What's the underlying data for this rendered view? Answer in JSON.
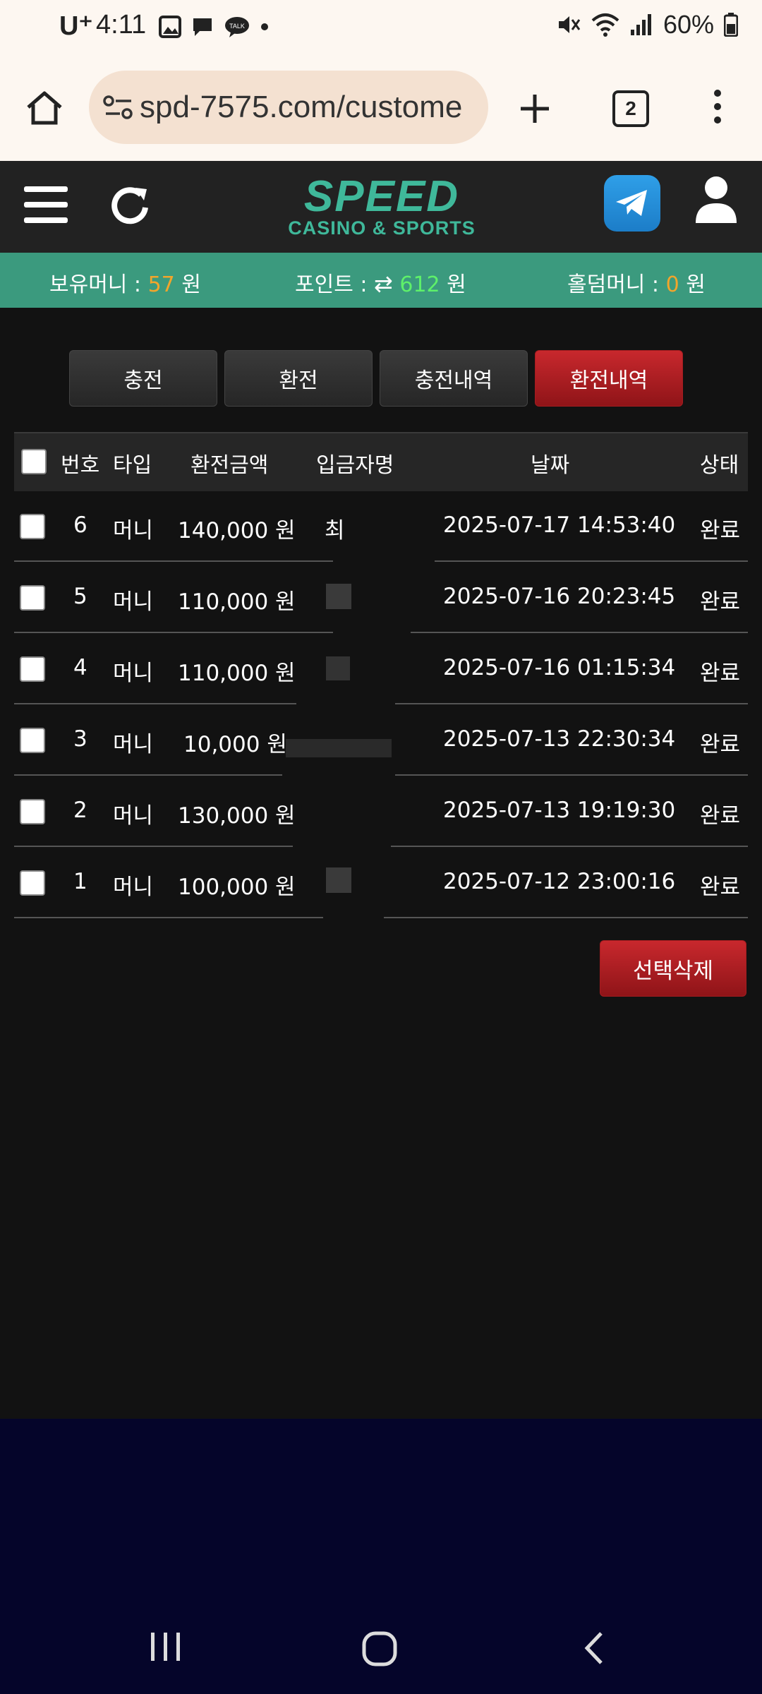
{
  "status": {
    "time": "4:11",
    "carrier": "U⁺",
    "battery": "60%"
  },
  "browser": {
    "url": "spd-7575.com/custome",
    "tab_count": "2"
  },
  "header": {
    "logo_main": "SPEED",
    "logo_sub": "CASINO & SPORTS"
  },
  "balance": {
    "money_label": "보유머니 :",
    "money_value": "57",
    "point_label": "포인트 :",
    "point_value": "612",
    "holdem_label": "홀덤머니 :",
    "holdem_value": "0",
    "unit": "원"
  },
  "tabs": [
    {
      "label": "충전"
    },
    {
      "label": "환전"
    },
    {
      "label": "충전내역"
    },
    {
      "label": "환전내역"
    }
  ],
  "table": {
    "headers": [
      "번호",
      "타입",
      "환전금액",
      "입금자명",
      "날짜",
      "상태"
    ],
    "rows": [
      {
        "no": "6",
        "type": "머니",
        "amount": "140,000 원",
        "name": "최",
        "date": "2025-07-17 14:53:40",
        "status": "완료"
      },
      {
        "no": "5",
        "type": "머니",
        "amount": "110,000 원",
        "name": "",
        "date": "2025-07-16 20:23:45",
        "status": "완료"
      },
      {
        "no": "4",
        "type": "머니",
        "amount": "110,000 원",
        "name": "",
        "date": "2025-07-16 01:15:34",
        "status": "완료"
      },
      {
        "no": "3",
        "type": "머니",
        "amount": "10,000 원",
        "name": "",
        "date": "2025-07-13 22:30:34",
        "status": "완료"
      },
      {
        "no": "2",
        "type": "머니",
        "amount": "130,000 원",
        "name": "",
        "date": "2025-07-13 19:19:30",
        "status": "완료"
      },
      {
        "no": "1",
        "type": "머니",
        "amount": "100,000 원",
        "name": "",
        "date": "2025-07-12 23:00:16",
        "status": "완료"
      }
    ]
  },
  "delete_button": "선택삭제",
  "colors": {
    "accent_green": "#3b9a7e",
    "active_red": "#b01e23",
    "orange_value": "#f2a52b",
    "green_value": "#5ef06a"
  }
}
